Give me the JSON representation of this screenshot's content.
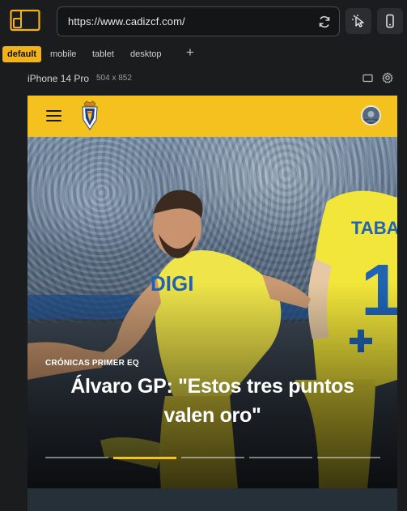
{
  "browser": {
    "url": "https://www.cadizcf.com/",
    "logo_icon": "responsive-layout-icon",
    "reload_icon": "reload-icon",
    "select_icon": "pointer-select-icon",
    "device_icon": "mobile-device-icon"
  },
  "device_tabs": [
    {
      "label": "default",
      "active": true
    },
    {
      "label": "mobile",
      "active": false
    },
    {
      "label": "tablet",
      "active": false
    },
    {
      "label": "desktop",
      "active": false
    }
  ],
  "add_tab_label": "+",
  "device": {
    "name": "iPhone 14 Pro",
    "size": "504 x 852"
  },
  "site": {
    "brand_color": "#f4c11e",
    "menu_icon": "hamburger-menu-icon",
    "logo_icon": "cadiz-cf-crest-icon",
    "avatar_icon": "user-avatar-icon",
    "hero": {
      "category": "CRÓNICAS PRIMER EQ",
      "title": "Álvaro GP: \"Estos tres puntos valen oro\"",
      "slide_count": 5,
      "active_slide": 2
    }
  }
}
